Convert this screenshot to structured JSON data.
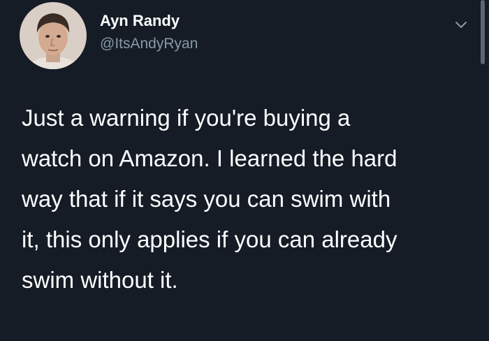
{
  "tweet": {
    "author": {
      "display_name": "Ayn Randy",
      "handle": "@ItsAndyRyan",
      "avatar_icon": "avatar-photo"
    },
    "menu_icon": "chevron-down-icon",
    "text": "Just a warning if you're buying a\nwatch on Amazon. I learned the hard\nway that if it says you can swim with\nit, this only applies if you can already\nswim without it."
  },
  "colors": {
    "background": "#151c26",
    "text_primary": "#ffffff",
    "text_secondary": "#8899a6"
  }
}
